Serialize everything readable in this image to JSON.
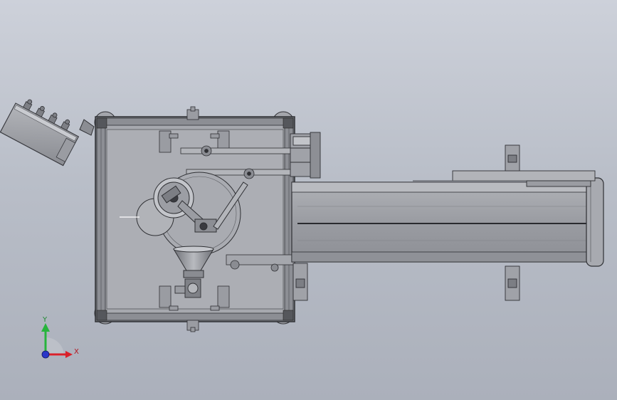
{
  "view": {
    "colors": {
      "frame": "#8f9197",
      "frame_dark": "#3a3b40",
      "plate": "#a5a7ad",
      "conveyor": "#9c9ea4",
      "belt_line": "#2a2b2f",
      "x_axis": "#d9202a",
      "y_axis": "#27b43c",
      "z_axis": "#2a36c8"
    }
  },
  "triad": {
    "x_label": "X",
    "y_label": "Y"
  }
}
